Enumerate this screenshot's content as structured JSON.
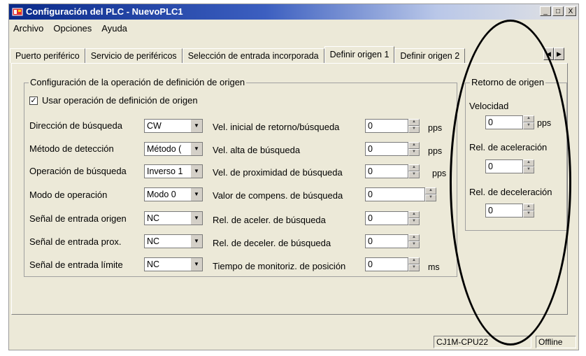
{
  "window": {
    "title": "Configuración del PLC - NuevoPLC1",
    "controls": [
      "_",
      "□",
      "X"
    ]
  },
  "menu": [
    "Archivo",
    "Opciones",
    "Ayuda"
  ],
  "tabs": [
    "Puerto periférico",
    "Servicio de periféricos",
    "Selección de entrada incorporada",
    "Definir origen 1",
    "Definir origen 2"
  ],
  "active_tab": "Definir origen 1",
  "origin_config": {
    "group_title": "Configuración de la operación de definición de origen",
    "use_checkbox": {
      "label": "Usar operación de definición de origen",
      "checked": "✓"
    },
    "left_rows": [
      {
        "label": "Dirección de búsqueda",
        "value": "CW"
      },
      {
        "label": "Método de detección",
        "value": "Método ("
      },
      {
        "label": "Operación de búsqueda",
        "value": "Inverso 1"
      },
      {
        "label": "Modo de operación",
        "value": "Modo 0"
      },
      {
        "label": "Señal de entrada origen",
        "value": "NC"
      },
      {
        "label": "Señal de entrada prox.",
        "value": "NC"
      },
      {
        "label": "Señal de entrada límite",
        "value": "NC"
      }
    ],
    "right_rows": [
      {
        "label": "Vel. inicial de retorno/búsqueda",
        "value": "0",
        "unit": "pps"
      },
      {
        "label": "Vel. alta de búsqueda",
        "value": "0",
        "unit": "pps"
      },
      {
        "label": "Vel. de proximidad de búsqueda",
        "value": "0",
        "unit": "pps"
      },
      {
        "label": "Valor de compens. de búsqueda",
        "value": "0",
        "unit": ""
      },
      {
        "label": "Rel. de aceler. de búsqueda",
        "value": "0",
        "unit": ""
      },
      {
        "label": "Rel. de deceler. de búsqueda",
        "value": "0",
        "unit": ""
      },
      {
        "label": "Tiempo de monitoriz. de posición",
        "value": "0",
        "unit": "ms"
      }
    ]
  },
  "return_origin": {
    "group_title": "Retorno de origen",
    "velocity_label": "Velocidad",
    "velocity_value": "0",
    "velocity_unit": "pps",
    "accel_label": "Rel. de aceleración",
    "accel_value": "0",
    "decel_label": "Rel. de deceleración",
    "decel_value": "0"
  },
  "status": {
    "cpu": "CJ1M-CPU22",
    "mode": "Offline"
  }
}
